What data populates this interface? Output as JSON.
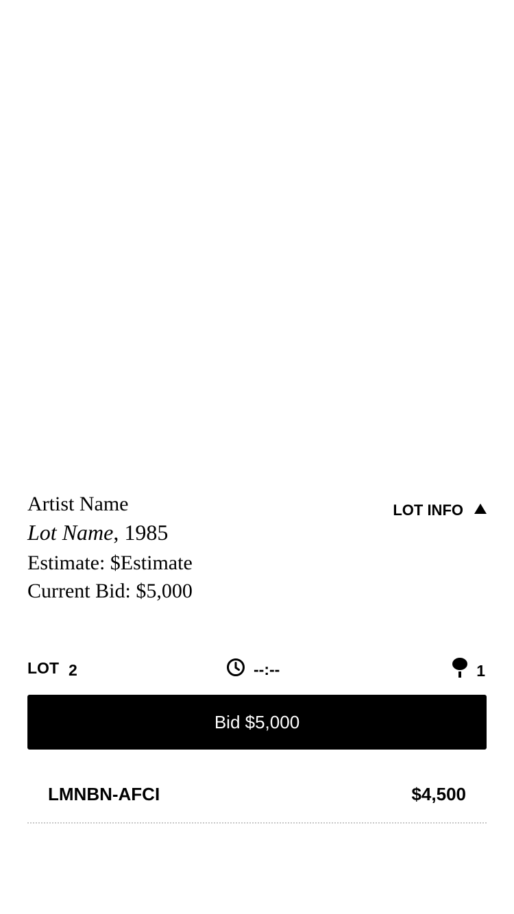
{
  "lot": {
    "artist_name": "Artist Name",
    "lot_name": "Lot Name",
    "year_suffix": ", 1985",
    "estimate": "Estimate: $Estimate",
    "current_bid": "Current Bid: $5,000",
    "lot_info_label": "LOT INFO"
  },
  "status": {
    "lot_label": "LOT",
    "lot_number": "2",
    "timer": "--:--",
    "bidder_count": "1"
  },
  "bid_button": {
    "label": "Bid $5,000"
  },
  "bid_history": {
    "rows": [
      {
        "bidder_id": "LMNBN-AFCI",
        "amount": "$4,500"
      }
    ]
  },
  "icons": {
    "lot_info_toggle": "triangle-up-icon",
    "timer": "clock-icon",
    "bidders": "paddle-icon"
  }
}
